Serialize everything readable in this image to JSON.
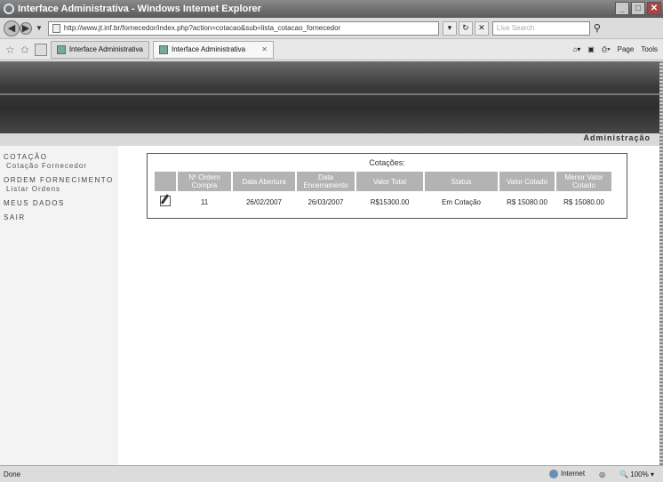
{
  "window": {
    "title": "Interface Administrativa - Windows Internet Explorer"
  },
  "address": {
    "url": "http://www.jt.inf.br/fornecedor/index.php?action=cotacao&sub=lista_cotacao_fornecedor",
    "search_placeholder": "Live Search"
  },
  "tabs": [
    {
      "label": "Interface Administrativa"
    },
    {
      "label": "Interface Administrativa"
    }
  ],
  "toolbar": {
    "page_label": "Page",
    "tools_label": "Tools"
  },
  "header": {
    "section": "Administração"
  },
  "sidebar": {
    "items": [
      {
        "label": "COTAÇÃO",
        "sub": "Cotação Fornecedor"
      },
      {
        "label": "ORDEM FORNECIMENTO",
        "sub": "Listar Ordens"
      },
      {
        "label": "MEUS DADOS"
      },
      {
        "label": "SAIR"
      }
    ]
  },
  "panel": {
    "title": "Cotações:",
    "columns": [
      "",
      "Nº Ordem Compra",
      "Data Abertura",
      "Data Encerramento",
      "Valor Total",
      "Status",
      "Valor Cotado",
      "Menor Valor Cotado"
    ],
    "rows": [
      {
        "ordem": "11",
        "abertura": "26/02/2007",
        "encerramento": "26/03/2007",
        "valor_total": "R$15300.00",
        "status": "Em Cotação",
        "valor_cotado": "R$ 15080.00",
        "menor_valor": "R$ 15080.00"
      }
    ]
  },
  "status": {
    "left": "Done",
    "zone": "Internet",
    "zoom": "100%"
  }
}
